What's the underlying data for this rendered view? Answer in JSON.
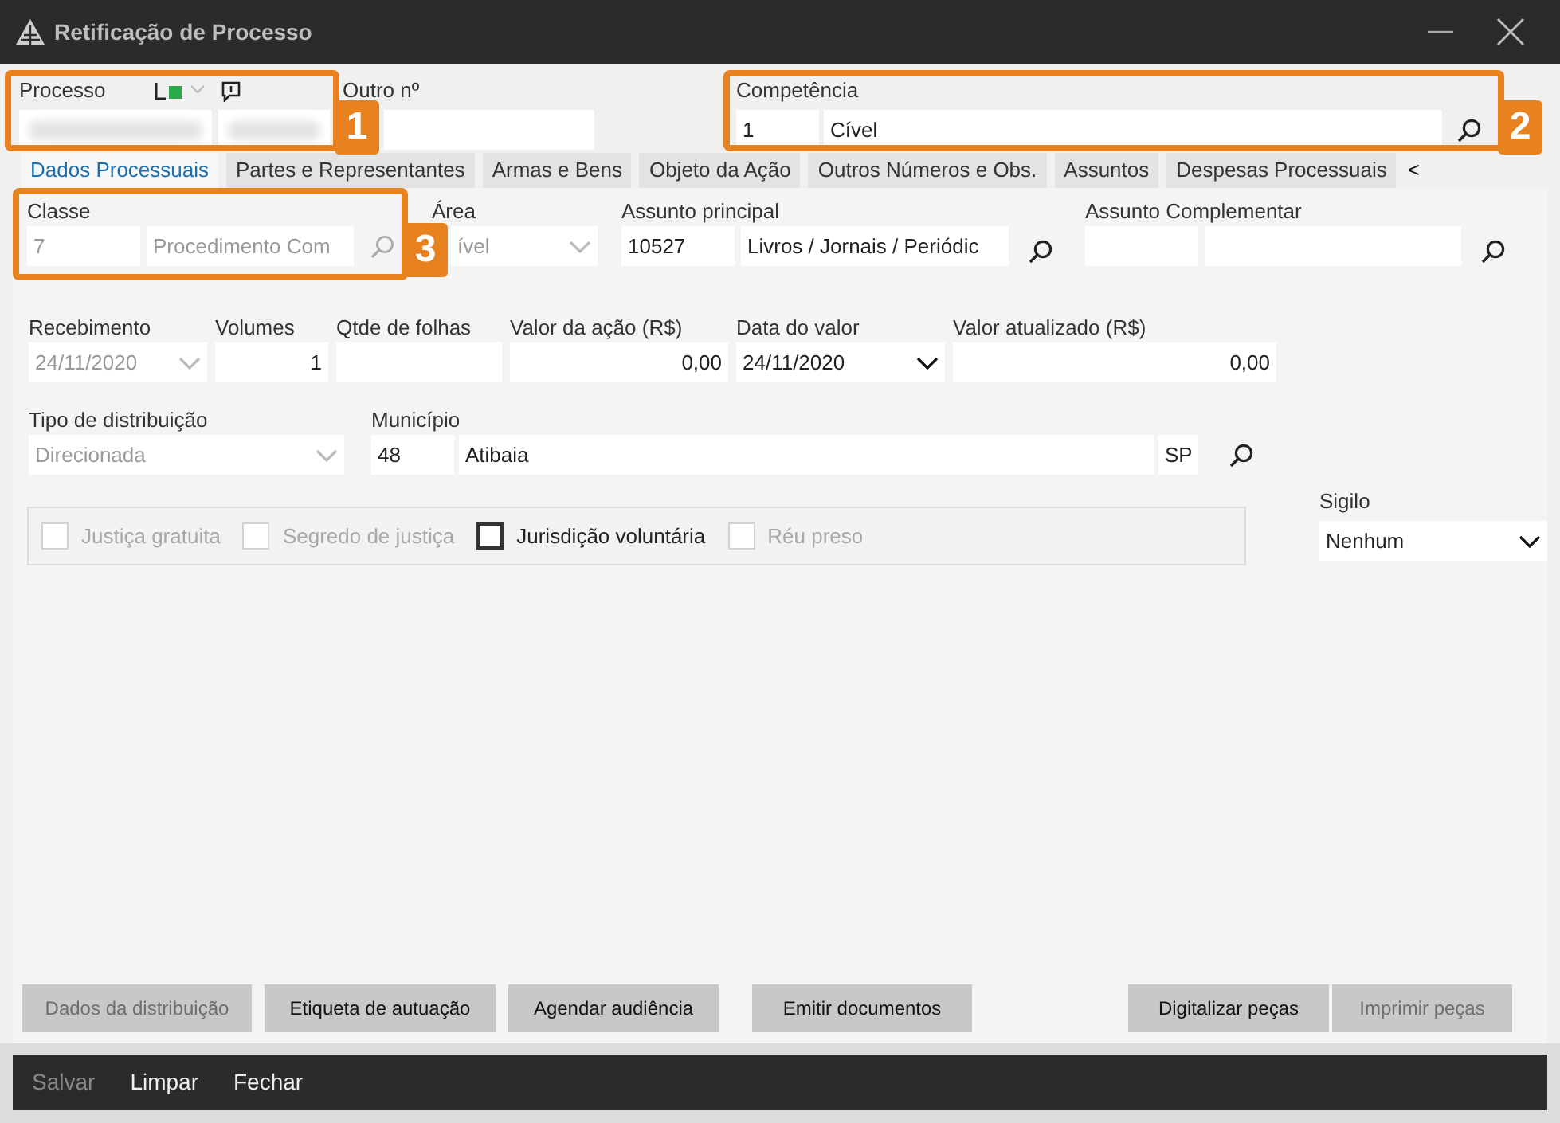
{
  "window": {
    "title": "Retificação de Processo"
  },
  "header": {
    "processo_label": "Processo",
    "outro_label": "Outro nº",
    "competencia_label": "Competência",
    "competencia_code": "1",
    "competencia_name": "Cível"
  },
  "callouts": [
    {
      "number": "1"
    },
    {
      "number": "2"
    },
    {
      "number": "3"
    }
  ],
  "tabs": [
    {
      "label": "Dados Processuais",
      "selected": true
    },
    {
      "label": "Partes e Representantes",
      "selected": false
    },
    {
      "label": "Armas e Bens",
      "selected": false
    },
    {
      "label": "Objeto da Ação",
      "selected": false
    },
    {
      "label": "Outros Números e Obs.",
      "selected": false
    },
    {
      "label": "Assuntos",
      "selected": false
    },
    {
      "label": "Despesas Processuais",
      "selected": false
    }
  ],
  "tab_scroll": "<",
  "classe": {
    "label": "Classe",
    "code": "7",
    "name": "Procedimento Com"
  },
  "area": {
    "label": "Área",
    "value": "ível"
  },
  "assunto_principal": {
    "label": "Assunto principal",
    "code": "10527",
    "name": "Livros / Jornais / Periódic"
  },
  "assunto_complementar": {
    "label": "Assunto Complementar"
  },
  "recebimento": {
    "label": "Recebimento",
    "value": "24/11/2020"
  },
  "volumes": {
    "label": "Volumes",
    "value": "1"
  },
  "qtde_folhas": {
    "label": "Qtde de folhas"
  },
  "valor_acao": {
    "label": "Valor da ação (R$)",
    "value": "0,00"
  },
  "data_valor": {
    "label": "Data do valor",
    "value": "24/11/2020"
  },
  "valor_atualizado": {
    "label": "Valor atualizado (R$)",
    "value": "0,00"
  },
  "tipo_distribuicao": {
    "label": "Tipo de distribuição",
    "value": "Direcionada"
  },
  "municipio": {
    "label": "Município",
    "code": "48",
    "name": "Atibaia",
    "uf": "SP"
  },
  "checkboxes": [
    {
      "label": "Justiça gratuita",
      "checked": false,
      "disabled": true
    },
    {
      "label": "Segredo de justiça",
      "checked": false,
      "disabled": true
    },
    {
      "label": "Jurisdição voluntária",
      "checked": false,
      "disabled": false
    },
    {
      "label": "Réu preso",
      "checked": false,
      "disabled": true
    }
  ],
  "sigilo": {
    "label": "Sigilo",
    "value": "Nenhum"
  },
  "buttons": [
    {
      "label": "Dados da distribuição",
      "disabled": true
    },
    {
      "label": "Etiqueta de autuação",
      "disabled": false
    },
    {
      "label": "Agendar audiência",
      "disabled": false
    },
    {
      "label": "Emitir documentos",
      "disabled": false
    },
    {
      "label": "Digitalizar peças",
      "disabled": false
    },
    {
      "label": "Imprimir peças",
      "disabled": true
    }
  ],
  "footer": [
    {
      "label": "Salvar",
      "disabled": true
    },
    {
      "label": "Limpar",
      "disabled": false
    },
    {
      "label": "Fechar",
      "disabled": false
    }
  ]
}
